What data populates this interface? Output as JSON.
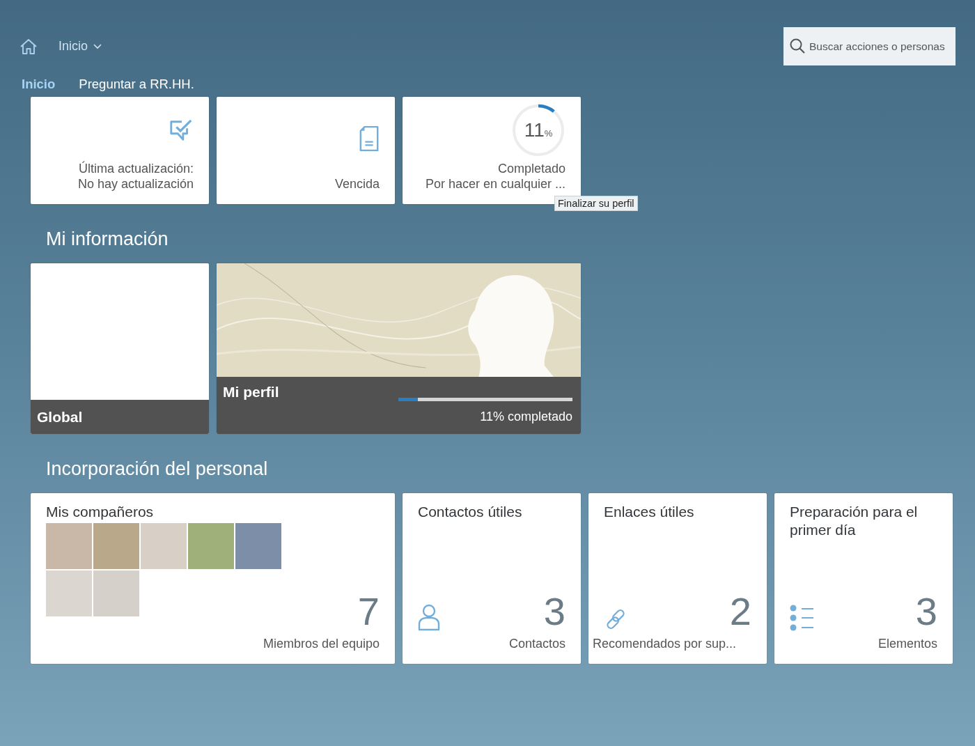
{
  "shell": {
    "home_menu": "Inicio",
    "search": {
      "placeholder": "Buscar acciones o personas"
    }
  },
  "tabs": [
    {
      "label": "Inicio",
      "selected": true
    },
    {
      "label": "Preguntar a RR.HH.",
      "selected": false
    }
  ],
  "top_tiles": [
    {
      "kind": "feedback",
      "lines": [
        "Última actualización:",
        "No hay actualización"
      ]
    },
    {
      "kind": "document",
      "lines": [
        "Vencida"
      ]
    },
    {
      "kind": "progress-ring",
      "value": "11",
      "unit": "%",
      "level": 0.11,
      "lines": [
        "Completado",
        "Por hacer en cualquier ..."
      ],
      "tooltip": "Finalizar su perfil"
    }
  ],
  "sections": [
    {
      "title": "Mi información",
      "tiles": [
        {
          "kind": "blank",
          "title": "Global"
        },
        {
          "kind": "profile",
          "title": "Mi perfil",
          "level": 0.11,
          "caption": "11% completado"
        }
      ]
    },
    {
      "title": "Incorporación del personal",
      "tiles": [
        {
          "kind": "team",
          "title": "Mis compañeros",
          "photos": [
            {
              "kind": "photo"
            },
            {
              "kind": "photo"
            },
            {
              "kind": "photo"
            },
            {
              "kind": "photo"
            },
            {
              "kind": "photo"
            },
            {
              "kind": "photo"
            },
            {
              "kind": "photo"
            }
          ],
          "number": "7",
          "footer": "Miembros del equipo"
        },
        {
          "kind": "contacts",
          "title": "Contactos útiles",
          "number": "3",
          "footer": "Contactos"
        },
        {
          "kind": "links",
          "title": "Enlaces útiles",
          "number": "2",
          "footer": "Recomendados por sup..."
        },
        {
          "kind": "list",
          "title": "Preparación para el primer día",
          "number": "3",
          "footer": "Elementos"
        }
      ]
    }
  ]
}
